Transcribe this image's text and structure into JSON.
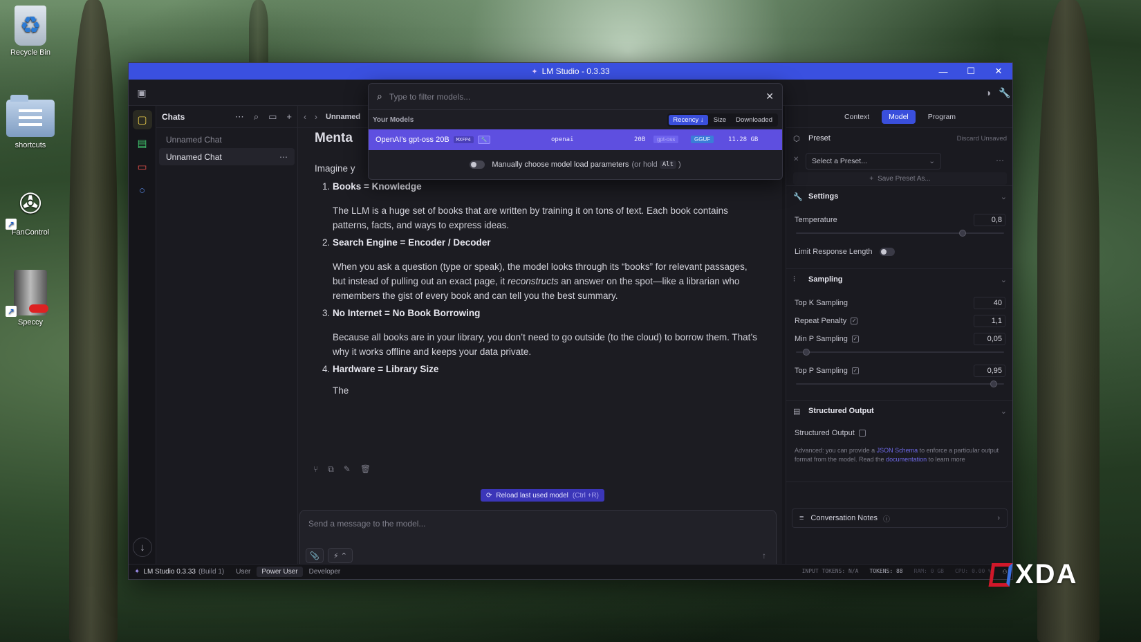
{
  "desktop": {
    "icons": [
      {
        "label": "Recycle Bin",
        "icon": "recycle-bin-icon"
      },
      {
        "label": "shortcuts",
        "icon": "folder-icon"
      },
      {
        "label": "FanControl",
        "icon": "fan-icon"
      },
      {
        "label": "Speccy",
        "icon": "computer-icon"
      }
    ]
  },
  "window": {
    "title": "LM Studio - 0.3.33",
    "controls": {
      "minimize": "—",
      "maximize": "☐",
      "close": "✕"
    }
  },
  "chats": {
    "title": "Chats",
    "items": [
      {
        "label": "Unnamed Chat"
      },
      {
        "label": "Unnamed Chat"
      }
    ]
  },
  "main": {
    "tab_name": "Unnamed",
    "title": "Menta",
    "intro": "Imagine y",
    "points": [
      {
        "head": "Books = Knowledge",
        "body": "The LLM is a huge set of books that are written by training it on tons of text. Each book contains patterns, facts, and ways to express ideas."
      },
      {
        "head": "Search Engine = Encoder / Decoder",
        "body_a": "When you ask a question (type or speak), the model looks through its “books” for relevant passages, but instead of pulling out an exact page, it ",
        "body_em": "reconstructs",
        "body_b": " an answer on the spot—like a librarian who remembers the gist of every book and can tell you the best summary."
      },
      {
        "head": "No Internet = No Book Borrowing",
        "body": "Because all books are in your library, you don’t need to go outside (to the cloud) to borrow them. That’s why it works offline and keeps your data private."
      },
      {
        "head": "Hardware = Library Size",
        "body": ""
      }
    ],
    "tail": "The",
    "reload_label": "Reload last used model",
    "reload_shortcut": "(Ctrl +R)",
    "composer_placeholder": "Send a message to the model..."
  },
  "picker": {
    "search_placeholder": "Type to filter models...",
    "section": "Your Models",
    "sort": {
      "recency": "Recency ↓",
      "size": "Size",
      "downloaded": "Downloaded"
    },
    "model": {
      "name": "OpenAI's gpt-oss 20B",
      "quant": "MXFP4",
      "publisher": "openai",
      "params": "20B",
      "arch": "gpt-oss",
      "format": "GGUF",
      "size": "11.28 GB"
    },
    "option_label": "Manually choose model load parameters",
    "option_hint_a": "(or hold",
    "option_key": "Alt",
    "option_hint_b": ")"
  },
  "right": {
    "tabs": {
      "context": "Context",
      "model": "Model",
      "program": "Program"
    },
    "preset": {
      "title": "Preset",
      "discard": "Discard Unsaved",
      "select": "Select a Preset...",
      "save_as": "Save Preset As..."
    },
    "settings": {
      "title": "Settings",
      "temperature_label": "Temperature",
      "temperature": "0,8",
      "temperature_level": 0.8,
      "limit_label": "Limit Response Length"
    },
    "sampling": {
      "title": "Sampling",
      "top_k_label": "Top K Sampling",
      "top_k": "40",
      "repeat_label": "Repeat Penalty",
      "repeat": "1,1",
      "min_p_label": "Min P Sampling",
      "min_p": "0,05",
      "min_p_level": 0.05,
      "top_p_label": "Top P Sampling",
      "top_p": "0,95",
      "top_p_level": 0.95
    },
    "structured": {
      "title": "Structured Output",
      "label": "Structured Output",
      "note_a": "Advanced: you can provide a ",
      "note_link": "JSON Schema",
      "note_b": " to enforce a particular output format from the model. Read the ",
      "note_link2": "documentation",
      "note_c": " to learn more"
    },
    "notes_label": "Conversation Notes"
  },
  "status": {
    "app": "LM Studio 0.3.33",
    "build": "(Build 1)",
    "modes": {
      "user": "User",
      "power": "Power User",
      "dev": "Developer"
    },
    "input_tokens": "INPUT TOKENS: N/A",
    "tokens": "TOKENS: 88",
    "ram": "RAM: 0 GB",
    "cpu": "CPU: 0.00 %"
  },
  "watermark": "XDA"
}
